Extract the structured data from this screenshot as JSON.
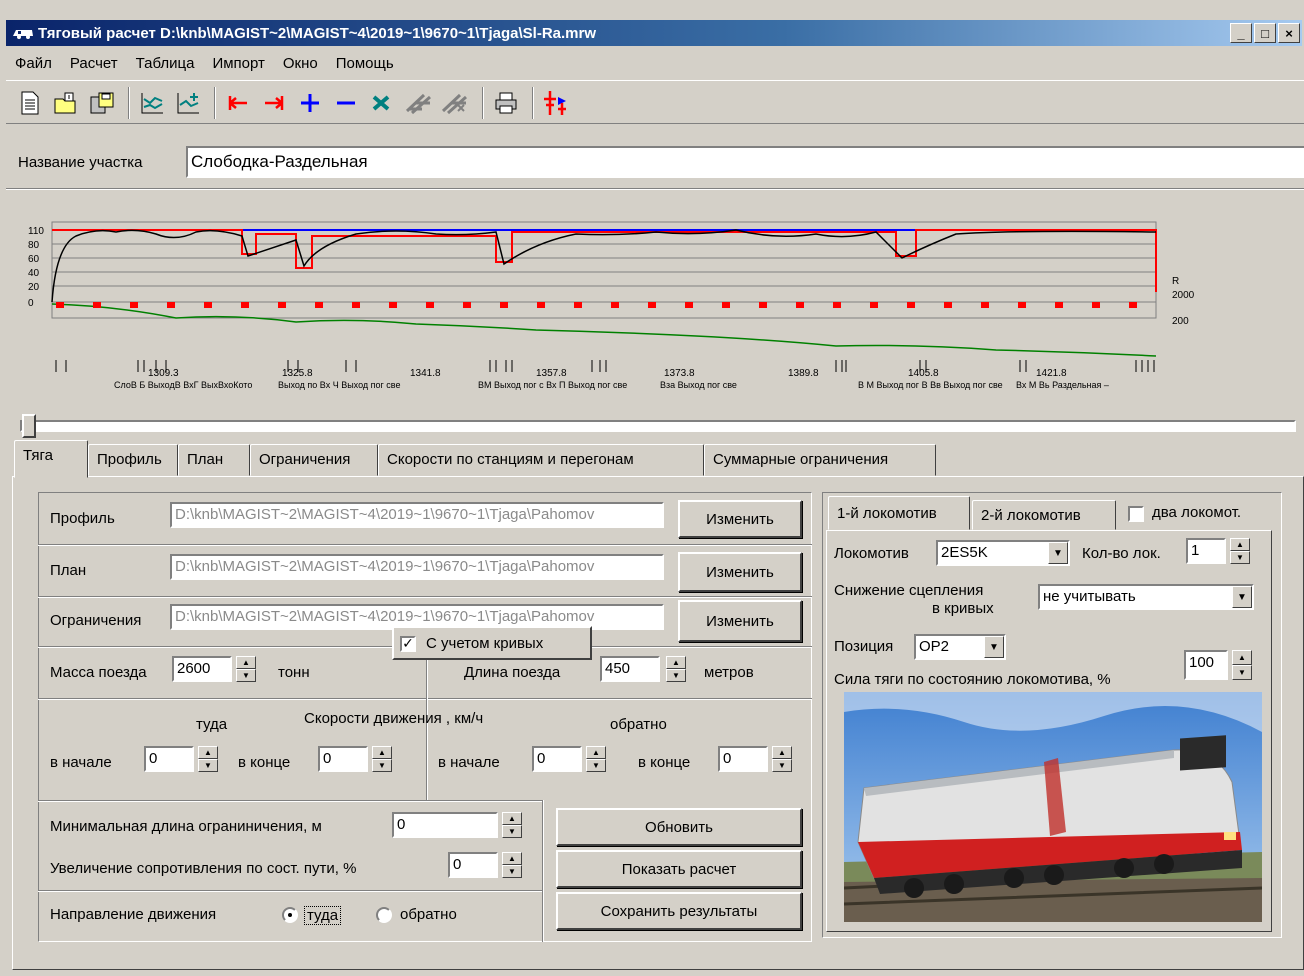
{
  "window": {
    "title": "Тяговый расчет   D:\\knb\\MAGIST~2\\MAGIST~4\\2019~1\\9670~1\\Tjaga\\Sl-Ra.mrw",
    "min_label": "_",
    "max_label": "□",
    "close_label": "×"
  },
  "menu": [
    "Файл",
    "Расчет",
    "Таблица",
    "Импорт",
    "Окно",
    "Помощь"
  ],
  "section": {
    "label": "Название участка",
    "value": "Слободка-Раздельная"
  },
  "profile_chart": {
    "y_ticks": [
      "110",
      "80",
      "60",
      "40",
      "20",
      "0"
    ],
    "right_labels": [
      "R",
      "2000",
      "200"
    ],
    "km_labels": [
      "1309.3",
      "1325.8",
      "1341.8",
      "1357.8",
      "1373.8",
      "1389.8",
      "1405.8",
      "1421.8"
    ],
    "station_labels": [
      "СлоВ Б ВыходВ ВхГ ВыхВхоКото",
      "Выход по Вх Ч Выход пог све",
      "ВМ Выход пог с Вх П Выход пог све",
      "Вза Выход пог све",
      "В М Выход пог В Вв Выход пог све",
      "Вх М Вь Раздельная –"
    ],
    "colors": {
      "speed": "#000000",
      "limit": "#ff0000",
      "max": "#0000ff",
      "profile": "#008000"
    }
  },
  "tabs": [
    "Тяга",
    "Профиль",
    "План",
    "Ограничения",
    "Скорости по станциям и перегонам",
    "Суммарные ограничения"
  ],
  "files": [
    {
      "label": "Профиль",
      "path": "D:\\knb\\MAGIST~2\\MAGIST~4\\2019~1\\9670~1\\Tjaga\\Pahomov",
      "button": "Изменить"
    },
    {
      "label": "План",
      "path": "D:\\knb\\MAGIST~2\\MAGIST~4\\2019~1\\9670~1\\Tjaga\\Pahomov",
      "button": "Изменить"
    },
    {
      "label": "Ограничения",
      "path": "D:\\knb\\MAGIST~2\\MAGIST~4\\2019~1\\9670~1\\Tjaga\\Pahomov",
      "button": "Изменить"
    }
  ],
  "curves_check": {
    "label": "С учетом кривых",
    "checked": true
  },
  "mass": {
    "label": "Масса поезда",
    "value": "2600",
    "unit": "тонн"
  },
  "length": {
    "label": "Длина поезда",
    "value": "450",
    "unit": "метров"
  },
  "speeds": {
    "title": "Скорости движения , км/ч",
    "forward": "туда",
    "backward": "обратно",
    "start_label": "в начале",
    "end_label": "в конце",
    "fwd_start": "0",
    "fwd_end": "0",
    "bwd_start": "0",
    "bwd_end": "0"
  },
  "min_length": {
    "label": "Минимальная длина ограниничения, м",
    "value": "0"
  },
  "resistance": {
    "label": "Увеличение сопротивления по сост. пути, %",
    "value": "0"
  },
  "direction": {
    "label": "Направление движения",
    "opt1": "туда",
    "opt2": "обратно",
    "selected": "туда"
  },
  "actions": {
    "refresh": "Обновить",
    "show": "Показать расчет",
    "save": "Сохранить результаты"
  },
  "loco": {
    "tab1": "1-й локомотив",
    "tab2": "2-й локомотив",
    "two_label": "два локомот.",
    "two_checked": false,
    "loco_label": "Локомотив",
    "loco_value": "2ES5K",
    "count_label": "Кол-во лок.",
    "count_value": "1",
    "adhesion_label1": "Снижение сцепления",
    "adhesion_label2": "в кривых",
    "adhesion_value": "не учитывать",
    "position_label": "Позиция",
    "position_value": "OP2",
    "force_label": "Сила тяги по состоянию локомотива, %",
    "force_value": "100"
  }
}
